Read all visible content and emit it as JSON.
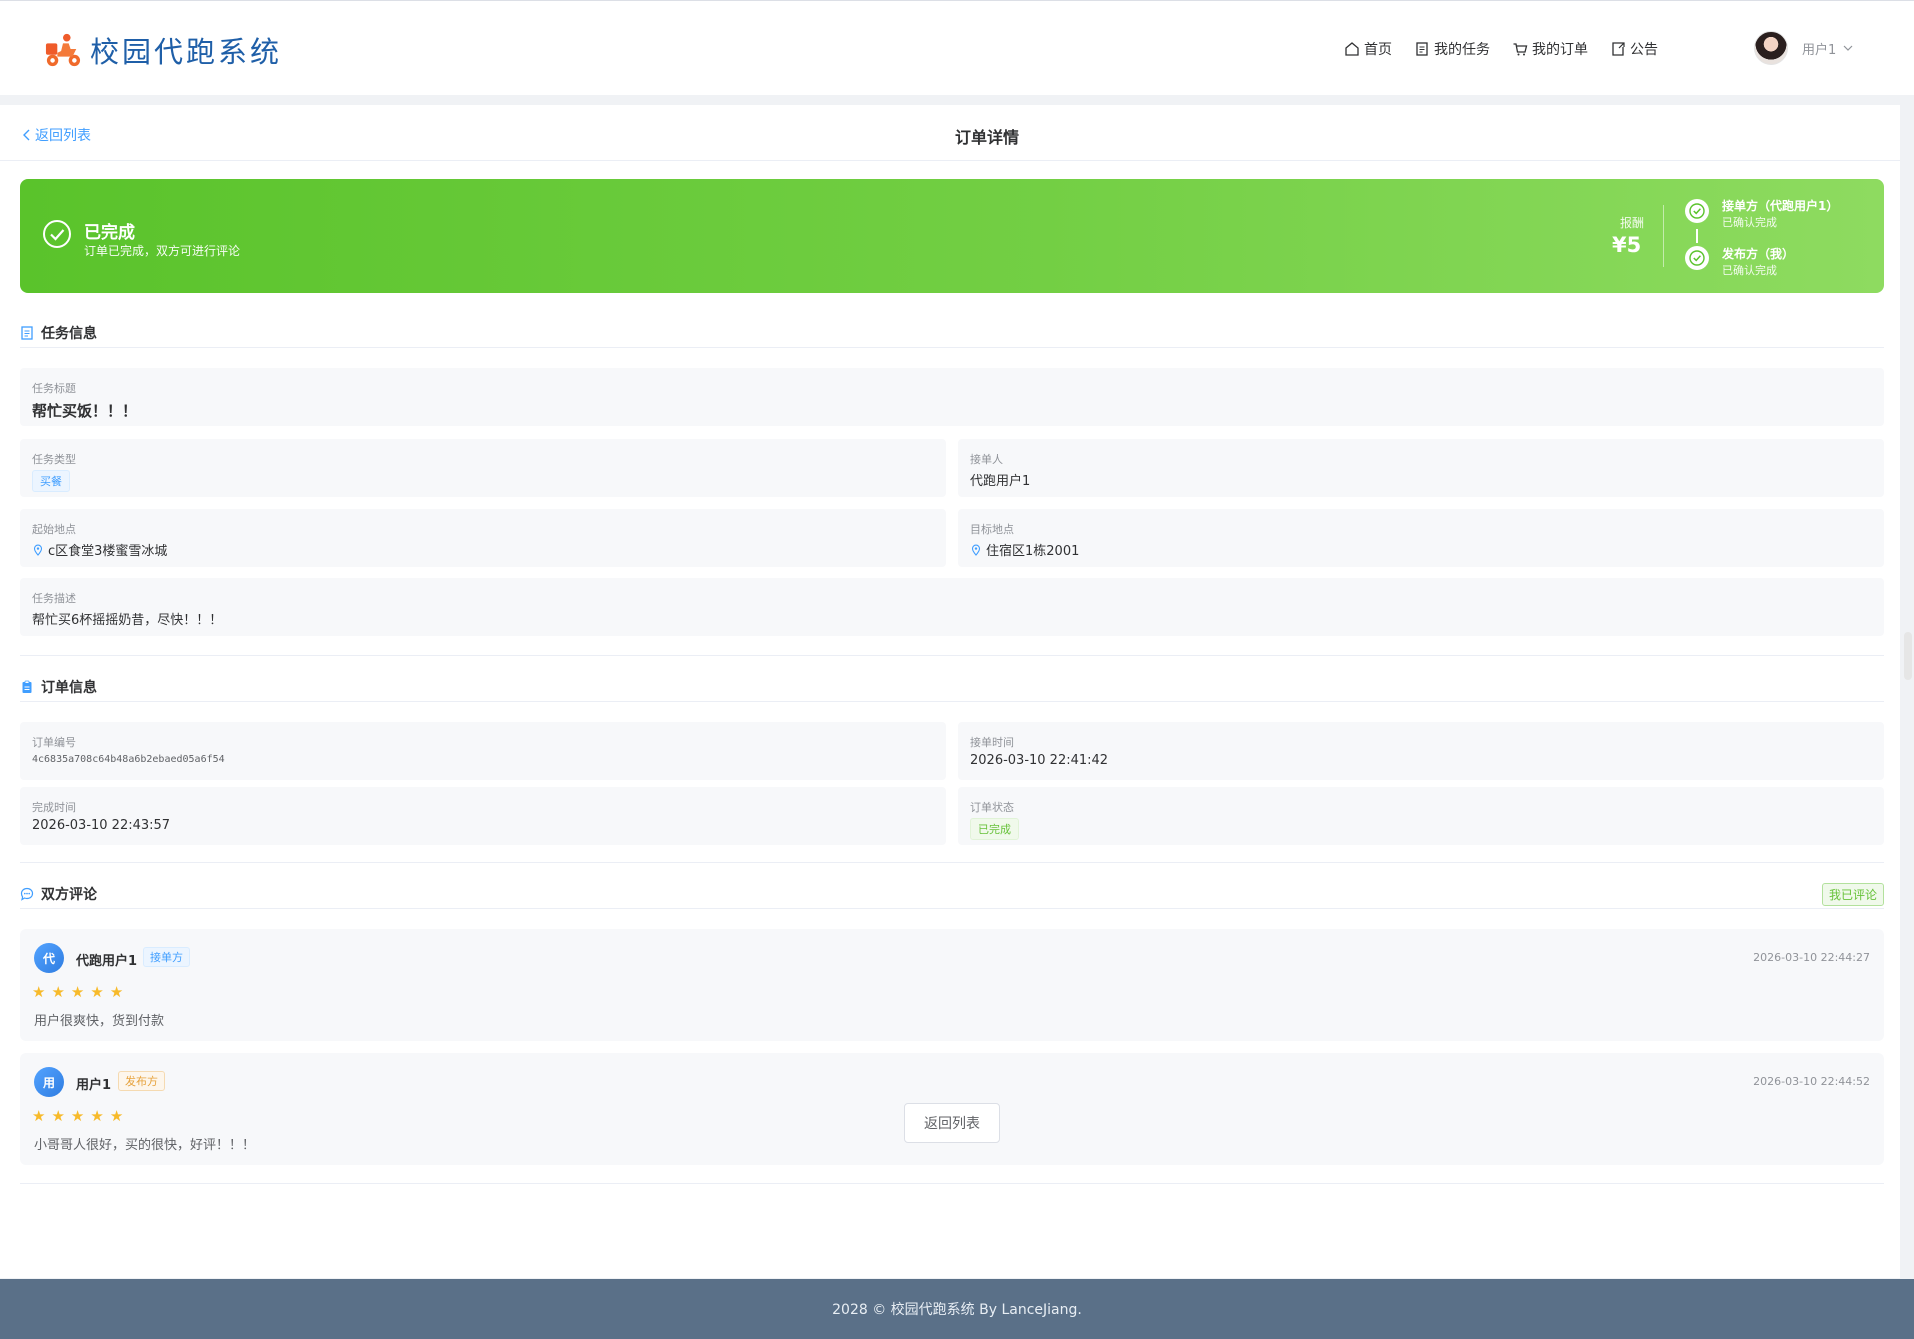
{
  "app": {
    "title": "校园代跑系统"
  },
  "nav": [
    {
      "label": "首页",
      "icon": "home-icon"
    },
    {
      "label": "我的任务",
      "icon": "document-icon"
    },
    {
      "label": "我的订单",
      "icon": "cart-icon"
    },
    {
      "label": "公告",
      "icon": "notice-icon"
    }
  ],
  "user": {
    "name": "用户1"
  },
  "header": {
    "back_label": "返回列表",
    "title": "订单详情"
  },
  "banner": {
    "status": "已完成",
    "subtitle": "订单已完成，双方可进行评论",
    "reward_label": "报酬",
    "reward_value": "¥5",
    "progress": [
      {
        "title": "接单方（代跑用户1）",
        "sub": "已确认完成"
      },
      {
        "title": "发布方（我）",
        "sub": "已确认完成"
      }
    ],
    "color_start": "#5ac32b",
    "color_end": "#8edb60"
  },
  "task_section": {
    "title": "任务信息",
    "task_title_label": "任务标题",
    "task_title": "帮忙买饭！！！",
    "type_label": "任务类型",
    "type_value": "买餐",
    "runner_label": "接单人",
    "runner_value": "代跑用户1",
    "start_label": "起始地点",
    "start_value": "c区食堂3楼蜜雪冰城",
    "target_label": "目标地点",
    "target_value": "住宿区1栋2001",
    "desc_label": "任务描述",
    "desc_value": "帮忙买6杯摇摇奶昔，尽快！！！"
  },
  "order_section": {
    "title": "订单信息",
    "order_no_label": "订单编号",
    "order_no": "4c6835a708c64b48a6b2ebaed05a6f54",
    "accept_time_label": "接单时间",
    "accept_time": "2026-03-10 22:41:42",
    "finish_time_label": "完成时间",
    "finish_time": "2026-03-10 22:43:57",
    "status_label": "订单状态",
    "status_value": "已完成"
  },
  "review_section": {
    "title": "双方评论",
    "badge": "我已评论",
    "reviews": [
      {
        "avatar_char": "代",
        "name": "代跑用户1",
        "role": "接单方",
        "time": "2026-03-10 22:44:27",
        "rating": 5,
        "text": "用户很爽快，货到付款"
      },
      {
        "avatar_char": "用",
        "name": "用户1",
        "role": "发布方",
        "time": "2026-03-10 22:44:52",
        "rating": 5,
        "text": "小哥哥人很好，买的很快，好评！！！"
      }
    ]
  },
  "bottom_button": "返回列表",
  "footer": {
    "text": "2028 © 校园代跑系统 By LanceJiang."
  }
}
